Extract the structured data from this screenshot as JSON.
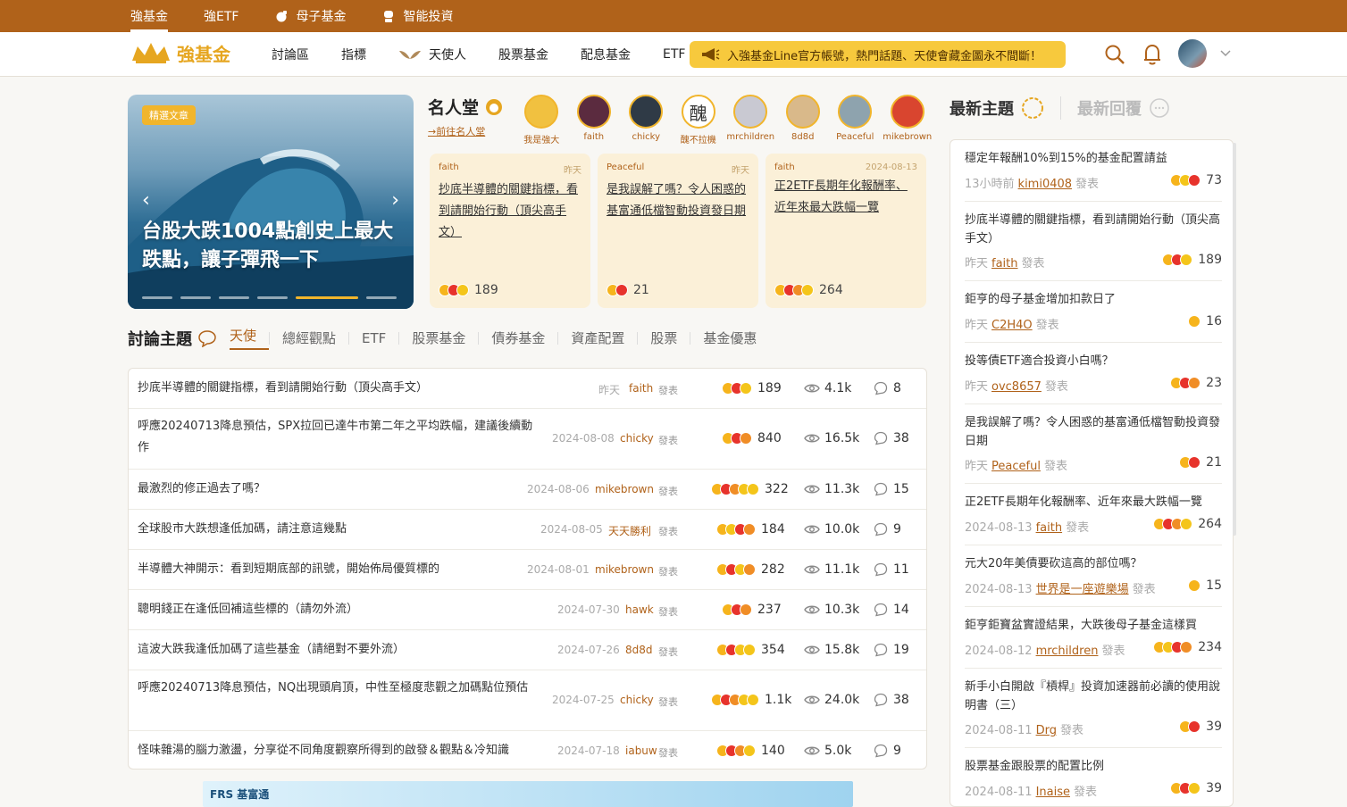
{
  "topbar": {
    "items": [
      {
        "label": "強基金",
        "active": true
      },
      {
        "label": "強ETF",
        "active": false
      },
      {
        "label": "母子基金",
        "active": false,
        "icon": "pig-icon"
      },
      {
        "label": "智能投資",
        "active": false,
        "icon": "robot-icon"
      }
    ]
  },
  "header": {
    "logo": "強基金",
    "nav": [
      "討論區",
      "指標",
      "天使人",
      "股票基金",
      "配息基金",
      "ETF"
    ],
    "promo": "入強基金Line官方帳號，熱門話題、天使會藏金圖永不間斷！"
  },
  "hero": {
    "badge": "精選文章",
    "title": "台股大跌1004點創史上最大跌點，讓子彈飛一下"
  },
  "hall": {
    "title": "名人堂",
    "link": "→前往名人堂",
    "members": [
      "我是強大",
      "faith",
      "chicky",
      "醜不拉機",
      "mrchildren",
      "8d8d",
      "Peaceful",
      "mikebrown"
    ]
  },
  "featured": [
    {
      "author": "faith",
      "time": "昨天",
      "title": "抄底半導體的關鍵指標，看到請開始行動（頂尖高手文）",
      "count": "189"
    },
    {
      "author": "Peaceful",
      "time": "昨天",
      "title": "是我誤解了嗎？令人困惑的基富通低檔智動投資發日期",
      "count": "21"
    },
    {
      "author": "faith",
      "time": "2024-08-13",
      "title": "正2ETF長期年化報酬率、近年來最大跌幅一覽",
      "count": "264"
    }
  ],
  "discuss": {
    "title": "討論主題",
    "tabs": [
      "天使",
      "總經觀點",
      "ETF",
      "股票基金",
      "債券基金",
      "資產配置",
      "股票",
      "基金優惠"
    ]
  },
  "posted": "發表",
  "threads": [
    {
      "title": "抄底半導體的關鍵指標，看到請開始行動（頂尖高手文）",
      "date": "昨天",
      "user": "faith",
      "reacts": "189",
      "views": "4.1k",
      "comments": "8"
    },
    {
      "title": "呼應20240713降息預估，SPX拉回已達牛市第二年之平均跌幅，建議後續動作",
      "date": "2024-08-08",
      "user": "chicky",
      "reacts": "840",
      "views": "16.5k",
      "comments": "38"
    },
    {
      "title": "最激烈的修正過去了嗎？",
      "date": "2024-08-06",
      "user": "mikebrown",
      "reacts": "322",
      "views": "11.3k",
      "comments": "15"
    },
    {
      "title": "全球股市大跌想逢低加碼，請注意這幾點",
      "date": "2024-08-05",
      "user": "天天勝利",
      "reacts": "184",
      "views": "10.0k",
      "comments": "9"
    },
    {
      "title": "半導體大神開示：看到短期底部的訊號，開始佈局優質標的",
      "date": "2024-08-01",
      "user": "mikebrown",
      "reacts": "282",
      "views": "11.1k",
      "comments": "11"
    },
    {
      "title": "聰明錢正在逢低回補這些標的（請勿外流）",
      "date": "2024-07-30",
      "user": "hawk",
      "reacts": "237",
      "views": "10.3k",
      "comments": "14"
    },
    {
      "title": "這波大跌我逢低加碼了這些基金（請絕對不要外流）",
      "date": "2024-07-26",
      "user": "8d8d",
      "reacts": "354",
      "views": "15.8k",
      "comments": "19"
    },
    {
      "title": "呼應20240713降息預估，NQ出現頭肩頂，中性至極度悲觀之加碼點位預估",
      "date": "2024-07-25",
      "user": "chicky",
      "reacts": "1.1k",
      "views": "24.0k",
      "comments": "38"
    },
    {
      "title": "怪味雜湯的腦力激盪，分享從不同角度觀察所得到的啟發＆觀點＆冷知識",
      "date": "2024-07-18",
      "user": "iabuw",
      "reacts": "140",
      "views": "5.0k",
      "comments": "9"
    }
  ],
  "right": {
    "tab_new": "最新主題",
    "tab_reply": "最新回覆",
    "items": [
      {
        "title": "穩定年報酬10%到15%的基金配置請益",
        "time": "13小時前",
        "user": "kimi0408",
        "count": "73"
      },
      {
        "title": "抄底半導體的關鍵指標，看到請開始行動（頂尖高手文）",
        "time": "昨天",
        "user": "faith",
        "count": "189"
      },
      {
        "title": "鉅亨的母子基金增加扣款日了",
        "time": "昨天",
        "user": "C2H4O",
        "count": "16"
      },
      {
        "title": "投等債ETF適合投資小白嗎？",
        "time": "昨天",
        "user": "ovc8657",
        "count": "23"
      },
      {
        "title": "是我誤解了嗎？令人困惑的基富通低檔智動投資發日期",
        "time": "昨天",
        "user": "Peaceful",
        "count": "21"
      },
      {
        "title": "正2ETF長期年化報酬率、近年來最大跌幅一覽",
        "time": "2024-08-13",
        "user": "faith",
        "count": "264"
      },
      {
        "title": "元大20年美債要砍這高的部位嗎？",
        "time": "2024-08-13",
        "user": "世界是一座遊樂場",
        "count": "15"
      },
      {
        "title": "鉅亨鉅寶盆實證結果，大跌後母子基金這樣買",
        "time": "2024-08-12",
        "user": "mrchildren",
        "count": "234"
      },
      {
        "title": "新手小白開啟『槓桿』投資加速器前必讀的使用說明書（三）",
        "time": "2024-08-11",
        "user": "Drg",
        "count": "39"
      },
      {
        "title": "股票基金跟股票的配置比例",
        "time": "2024-08-11",
        "user": "Inaise",
        "count": "39"
      }
    ]
  },
  "banner": {
    "label": "FRS 基富通"
  }
}
